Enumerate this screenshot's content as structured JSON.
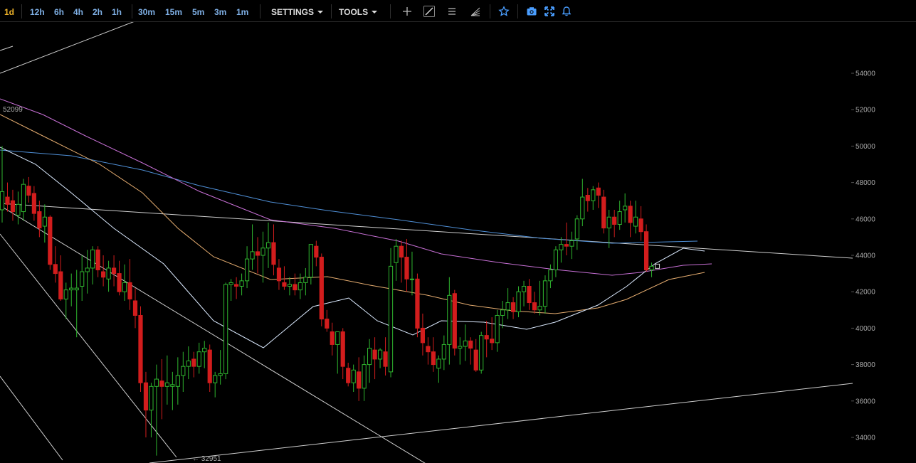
{
  "toolbar": {
    "timeframes": [
      "1d",
      "12h",
      "6h",
      "4h",
      "2h",
      "1h",
      "30m",
      "15m",
      "5m",
      "3m",
      "1m"
    ],
    "active_timeframe": "1d",
    "settings_label": "SETTINGS",
    "tools_label": "TOOLS",
    "icons": [
      "crosshair-icon",
      "line-tool-icon",
      "hamburger-menu-icon",
      "fib-fan-icon",
      "star-icon",
      "camera-icon",
      "fullscreen-icon",
      "alert-bell-icon"
    ]
  },
  "chart": {
    "y_axis_labels": [
      "54000",
      "52000",
      "50000",
      "48000",
      "46000",
      "44000",
      "42000",
      "40000",
      "38000",
      "36000",
      "34000"
    ],
    "y_ticks": [
      54000,
      52000,
      50000,
      48000,
      46000,
      44000,
      42000,
      40000,
      38000,
      36000,
      34000
    ],
    "high_marker": "52099",
    "low_marker": "← 32951",
    "colors": {
      "up": "#2fb62f",
      "down": "#d21d1d",
      "background": "#000000"
    }
  }
}
